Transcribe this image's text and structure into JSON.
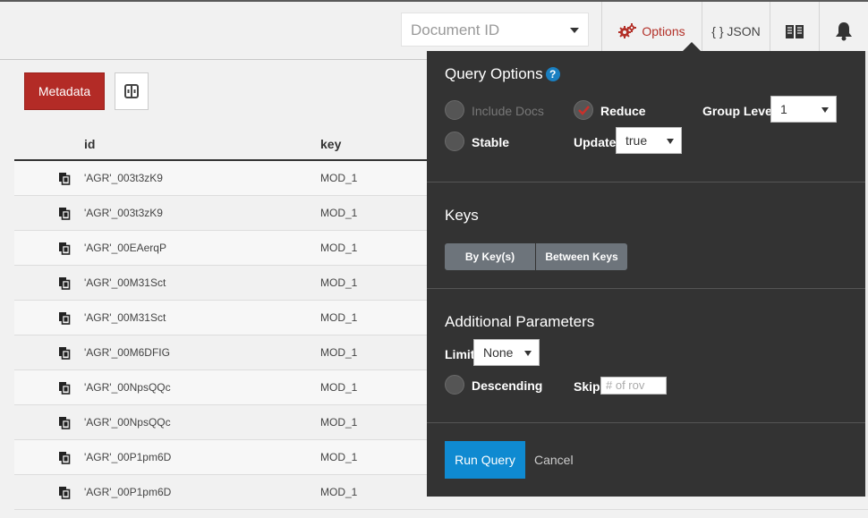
{
  "header": {
    "doc_id_placeholder": "Document ID",
    "options_label": "Options",
    "json_label": "{ } JSON",
    "icons": {
      "options": "gears-icon",
      "docs": "book-icon",
      "notifications": "bell-icon"
    }
  },
  "toolbar": {
    "metadata_label": "Metadata",
    "columns_icon": "column-toggle-icon"
  },
  "table": {
    "columns": [
      "id",
      "key"
    ],
    "rows": [
      {
        "id": "'AGR'_003t3zK9",
        "key": "MOD_1"
      },
      {
        "id": "'AGR'_003t3zK9",
        "key": "MOD_1"
      },
      {
        "id": "'AGR'_00EAerqP",
        "key": "MOD_1"
      },
      {
        "id": "'AGR'_00M31Sct",
        "key": "MOD_1"
      },
      {
        "id": "'AGR'_00M31Sct",
        "key": "MOD_1"
      },
      {
        "id": "'AGR'_00M6DFIG",
        "key": "MOD_1"
      },
      {
        "id": "'AGR'_00NpsQQc",
        "key": "MOD_1"
      },
      {
        "id": "'AGR'_00NpsQQc",
        "key": "MOD_1"
      },
      {
        "id": "'AGR'_00P1pm6D",
        "key": "MOD_1"
      },
      {
        "id": "'AGR'_00P1pm6D",
        "key": "MOD_1"
      }
    ]
  },
  "options_panel": {
    "title": "Query Options",
    "include_docs_label": "Include Docs",
    "reduce_label": "Reduce",
    "group_level_label": "Group Level",
    "group_level_value": "1",
    "stable_label": "Stable",
    "update_label": "Update",
    "update_value": "true",
    "keys_title": "Keys",
    "by_keys_label": "By Key(s)",
    "between_keys_label": "Between Keys",
    "additional_title": "Additional Parameters",
    "limit_label": "Limit",
    "limit_value": "None",
    "descending_label": "Descending",
    "skip_label": "Skip",
    "skip_placeholder": "# of rov",
    "run_query_label": "Run Query",
    "cancel_label": "Cancel",
    "reduce_checked": true,
    "accent_color": "#0f8ad1",
    "brand_color": "#b32b26"
  }
}
